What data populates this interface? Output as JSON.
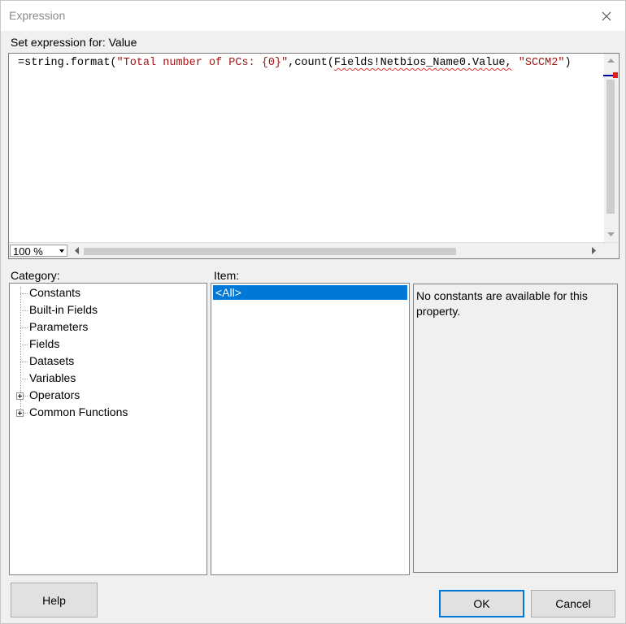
{
  "window": {
    "title": "Expression"
  },
  "editor": {
    "label": "Set expression for: Value",
    "code_pre": "=string.format(",
    "code_str1": "\"Total number of PCs: {0}\"",
    "code_mid": ",count(",
    "code_field": "Fields!Netbios_Name0.Value,",
    "code_space": " ",
    "code_str2": "\"SCCM2\"",
    "code_post": ")",
    "zoom": "100 %"
  },
  "category": {
    "label": "Category:",
    "items": [
      {
        "label": "Constants"
      },
      {
        "label": "Built-in Fields"
      },
      {
        "label": "Parameters"
      },
      {
        "label": "Fields"
      },
      {
        "label": "Datasets"
      },
      {
        "label": "Variables"
      },
      {
        "label": "Operators"
      },
      {
        "label": "Common Functions"
      }
    ]
  },
  "item": {
    "label": "Item:",
    "items": [
      {
        "label": "<All>"
      }
    ]
  },
  "description": {
    "text": "No constants are available for this property."
  },
  "buttons": {
    "help": "Help",
    "ok": "OK",
    "cancel": "Cancel"
  },
  "colors": {
    "selection": "#0078d7",
    "string": "#a31515",
    "accent": "#0078d7"
  }
}
